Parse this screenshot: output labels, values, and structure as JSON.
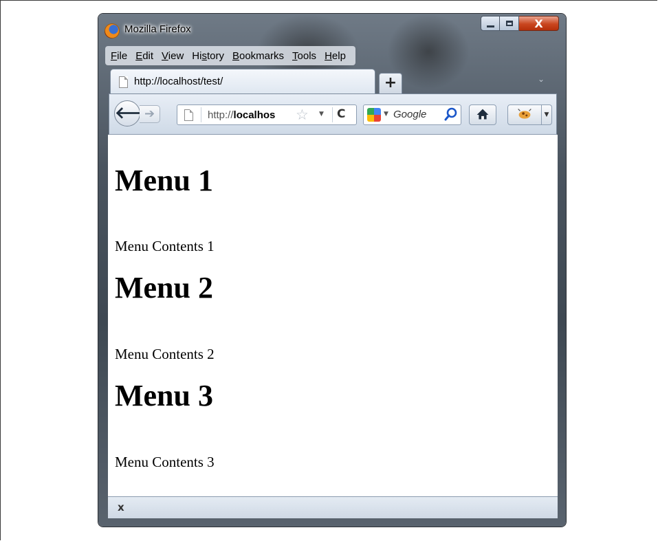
{
  "window": {
    "title": "Mozilla Firefox",
    "buttons": {
      "minimize": "",
      "maximize": "",
      "close": "X"
    },
    "icon": "firefox-logo"
  },
  "menubar": {
    "items": [
      {
        "label": "File",
        "accel": "F",
        "rest": "ile"
      },
      {
        "label": "Edit",
        "accel": "E",
        "rest": "dit"
      },
      {
        "label": "View",
        "accel": "V",
        "rest": "iew"
      },
      {
        "label": "History",
        "pre": "Hi",
        "accel": "s",
        "rest": "tory"
      },
      {
        "label": "Bookmarks",
        "accel": "B",
        "rest": "ookmarks"
      },
      {
        "label": "Tools",
        "accel": "T",
        "rest": "ools"
      },
      {
        "label": "Help",
        "accel": "H",
        "rest": "elp"
      }
    ]
  },
  "tabs": {
    "active": {
      "title": "http://localhost/test/",
      "icon": "page-icon"
    },
    "new_tab_label": "+",
    "list_all_glyph": "⌄"
  },
  "navbar": {
    "back_glyph": "🡐",
    "forward_glyph": "➔",
    "url": {
      "prefix": "http://",
      "host": "localhos"
    },
    "bookmark_star": "☆",
    "reload_glyph": "C",
    "search": {
      "engine": "Google",
      "placeholder": "Google"
    },
    "icons": [
      "back-icon",
      "forward-icon",
      "star-icon",
      "reload-icon",
      "google-icon",
      "magnifier-icon",
      "home-icon",
      "addon-icon"
    ]
  },
  "page": {
    "sections": [
      {
        "heading": "Menu 1",
        "contents": "Menu Contents 1"
      },
      {
        "heading": "Menu 2",
        "contents": "Menu Contents 2"
      },
      {
        "heading": "Menu 3",
        "contents": "Menu Contents 3"
      }
    ]
  },
  "statusbar": {
    "close_label": "x"
  }
}
